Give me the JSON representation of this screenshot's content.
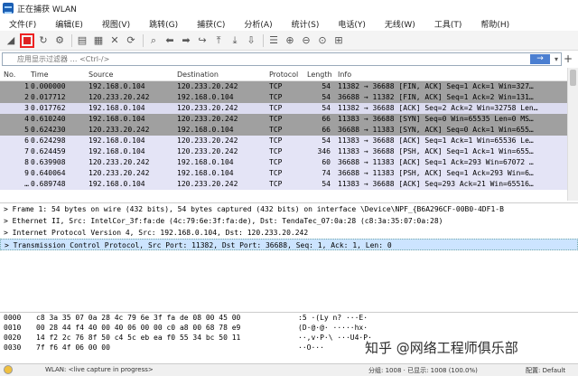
{
  "window": {
    "title": "正在捕获 WLAN"
  },
  "menu": [
    "文件(F)",
    "编辑(E)",
    "视图(V)",
    "跳转(G)",
    "捕获(C)",
    "分析(A)",
    "统计(S)",
    "电话(Y)",
    "无线(W)",
    "工具(T)",
    "帮助(H)"
  ],
  "toolbar": {
    "icons": [
      {
        "name": "shark-fin-start-icon",
        "glyph": "◢"
      },
      {
        "name": "stop-capture-icon",
        "glyph": ""
      },
      {
        "name": "restart-capture-icon",
        "glyph": "↻"
      },
      {
        "name": "capture-options-icon",
        "glyph": "⚙"
      },
      {
        "name": "open-file-icon",
        "glyph": "▤"
      },
      {
        "name": "save-file-icon",
        "glyph": "▦"
      },
      {
        "name": "close-file-icon",
        "glyph": "✕"
      },
      {
        "name": "reload-icon",
        "glyph": "⟳"
      },
      {
        "name": "find-packet-icon",
        "glyph": "⌕"
      },
      {
        "name": "go-back-icon",
        "glyph": "⬅"
      },
      {
        "name": "go-forward-icon",
        "glyph": "➡"
      },
      {
        "name": "go-to-packet-icon",
        "glyph": "↪"
      },
      {
        "name": "go-first-icon",
        "glyph": "⤒"
      },
      {
        "name": "go-last-icon",
        "glyph": "⤓"
      },
      {
        "name": "auto-scroll-icon",
        "glyph": "⇩"
      },
      {
        "name": "colorize-icon",
        "glyph": "☰"
      },
      {
        "name": "zoom-in-icon",
        "glyph": "⊕"
      },
      {
        "name": "zoom-out-icon",
        "glyph": "⊖"
      },
      {
        "name": "zoom-normal-icon",
        "glyph": "⊙"
      },
      {
        "name": "resize-columns-icon",
        "glyph": "⊞"
      }
    ]
  },
  "filter": {
    "placeholder": "应用显示过滤器 … <Ctrl-/>",
    "apply_glyph": "→",
    "dropdown_glyph": "▾",
    "add_glyph": "+"
  },
  "packet_list": {
    "columns": [
      "No.",
      "Time",
      "Source",
      "Destination",
      "Protocol",
      "Length",
      "Info"
    ],
    "rows": [
      {
        "no": "1",
        "time": "0.000000",
        "src": "192.168.0.104",
        "dst": "120.233.20.242",
        "proto": "TCP",
        "len": "54",
        "info": "11382 → 36688 [FIN, ACK] Seq=1 Ack=1 Win=327…",
        "bg": "#a0a0a0"
      },
      {
        "no": "2",
        "time": "0.017712",
        "src": "120.233.20.242",
        "dst": "192.168.0.104",
        "proto": "TCP",
        "len": "54",
        "info": "36688 → 11382 [FIN, ACK] Seq=1 Ack=2 Win=131…",
        "bg": "#a0a0a0"
      },
      {
        "no": "3",
        "time": "0.017762",
        "src": "192.168.0.104",
        "dst": "120.233.20.242",
        "proto": "TCP",
        "len": "54",
        "info": "11382 → 36688 [ACK] Seq=2 Ack=2 Win=32758 Len…",
        "bg": "#dcdcf0"
      },
      {
        "no": "4",
        "time": "0.610240",
        "src": "192.168.0.104",
        "dst": "120.233.20.242",
        "proto": "TCP",
        "len": "66",
        "info": "11383 → 36688 [SYN] Seq=0 Win=65535 Len=0 MS…",
        "bg": "#a0a0a0"
      },
      {
        "no": "5",
        "time": "0.624230",
        "src": "120.233.20.242",
        "dst": "192.168.0.104",
        "proto": "TCP",
        "len": "66",
        "info": "36688 → 11383 [SYN, ACK] Seq=0 Ack=1 Win=655…",
        "bg": "#a0a0a0"
      },
      {
        "no": "6",
        "time": "0.624298",
        "src": "192.168.0.104",
        "dst": "120.233.20.242",
        "proto": "TCP",
        "len": "54",
        "info": "11383 → 36688 [ACK] Seq=1 Ack=1 Win=65536 Le…",
        "bg": "#e4e4f6"
      },
      {
        "no": "7",
        "time": "0.624459",
        "src": "192.168.0.104",
        "dst": "120.233.20.242",
        "proto": "TCP",
        "len": "346",
        "info": "11383 → 36688 [PSH, ACK] Seq=1 Ack=1 Win=655…",
        "bg": "#e4e4f6"
      },
      {
        "no": "8",
        "time": "0.639908",
        "src": "120.233.20.242",
        "dst": "192.168.0.104",
        "proto": "TCP",
        "len": "60",
        "info": "36688 → 11383 [ACK] Seq=1 Ack=293 Win=67072 …",
        "bg": "#e4e4f6"
      },
      {
        "no": "9",
        "time": "0.640064",
        "src": "120.233.20.242",
        "dst": "192.168.0.104",
        "proto": "TCP",
        "len": "74",
        "info": "36688 → 11383 [PSH, ACK] Seq=1 Ack=293 Win=6…",
        "bg": "#e4e4f6"
      },
      {
        "no": "…",
        "time": "0.689748",
        "src": "192.168.0.104",
        "dst": "120.233.20.242",
        "proto": "TCP",
        "len": "54",
        "info": "11383 → 36688 [ACK] Seq=293 Ack=21 Win=65516…",
        "bg": "#e4e4f6"
      }
    ]
  },
  "details": [
    "> Frame 1: 54 bytes on wire (432 bits), 54 bytes captured (432 bits) on interface \\Device\\NPF_{B6A296CF-00B0-4DF1-B",
    "> Ethernet II, Src: IntelCor_3f:fa:de (4c:79:6e:3f:fa:de), Dst: TendaTec_07:0a:28 (c8:3a:35:07:0a:28)",
    "> Internet Protocol Version 4, Src: 192.168.0.104, Dst: 120.233.20.242",
    "> Transmission Control Protocol, Src Port: 11382, Dst Port: 36688, Seq: 1, Ack: 1, Len: 0"
  ],
  "bytes": [
    {
      "off": "0000",
      "hex": "c8 3a 35 07 0a 28 4c 79  6e 3f fa de 08 00 45 00",
      "ascii": ":5 ·(Ly n? ···E·"
    },
    {
      "off": "0010",
      "hex": "00 28 44 f4 40 00 40 06  00 00 c0 a8 00 68 78 e9",
      "ascii": "(D·@·@· ·····hx·"
    },
    {
      "off": "0020",
      "hex": "14 f2 2c 76 8f 50 c4 5c  eb ea f0 55 34 bc 50 11",
      "ascii": "··,v·P·\\ ···U4·P·"
    },
    {
      "off": "0030",
      "hex": "7f f6 4f 06 00 00",
      "ascii": "··O···"
    }
  ],
  "status": {
    "text": "WLAN: <live capture in progress>",
    "packets": "分组: 1008 · 已显示: 1008 (100.0%)",
    "profile": "配置: Default"
  },
  "watermark": "知乎 @网络工程师俱乐部"
}
